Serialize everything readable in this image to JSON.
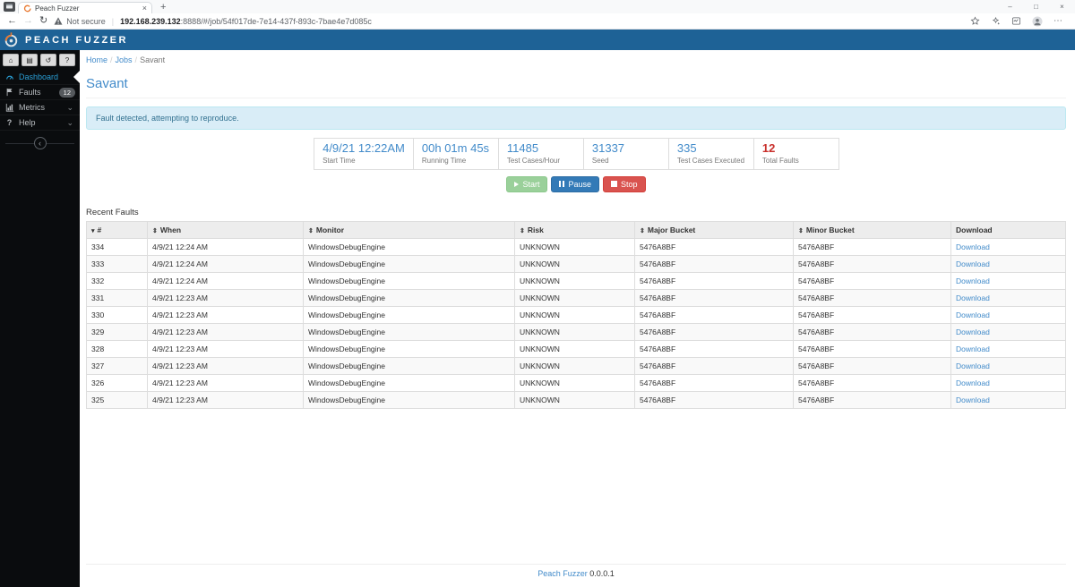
{
  "browser": {
    "tab_title": "Peach Fuzzer",
    "security_label": "Not secure",
    "url_divider": "|",
    "url_host": "192.168.239.132",
    "url_path": ":8888/#/job/54f017de-7e14-437f-893c-7bae4e7d085c"
  },
  "icons": {
    "back": "←",
    "forward": "→",
    "refresh": "↻",
    "minimize": "–",
    "maximize": "□",
    "close": "×",
    "new_tab": "+",
    "tab_close": "×",
    "menu_ellipsis": "⋯",
    "home": "⌂",
    "book": "▤",
    "history": "↺",
    "help": "?",
    "chevron_down": "⌄",
    "collapse": "‹",
    "sort_desc": "▾",
    "sort_both": "⇕"
  },
  "header": {
    "brand": "PEACH FUZZER"
  },
  "sidebar": {
    "items": [
      {
        "label": "Dashboard"
      },
      {
        "label": "Faults",
        "badge": "12"
      },
      {
        "label": "Metrics"
      },
      {
        "label": "Help"
      }
    ]
  },
  "breadcrumb": {
    "items": [
      "Home",
      "Jobs",
      "Savant"
    ],
    "separator": "/"
  },
  "page": {
    "title": "Savant",
    "alert": "Fault detected, attempting to reproduce."
  },
  "stats": [
    {
      "value": "4/9/21 12:22AM",
      "label": "Start Time"
    },
    {
      "value": "00h 01m 45s",
      "label": "Running Time"
    },
    {
      "value": "11485",
      "label": "Test Cases/Hour"
    },
    {
      "value": "31337",
      "label": "Seed"
    },
    {
      "value": "335",
      "label": "Test Cases Executed"
    },
    {
      "value": "12",
      "label": "Total Faults"
    }
  ],
  "controls": {
    "start": "Start",
    "pause": "Pause",
    "stop": "Stop"
  },
  "recent_faults": {
    "heading": "Recent Faults",
    "columns": [
      "#",
      "When",
      "Monitor",
      "Risk",
      "Major Bucket",
      "Minor Bucket",
      "Download"
    ],
    "rows": [
      {
        "num": "334",
        "when": "4/9/21 12:24 AM",
        "monitor": "WindowsDebugEngine",
        "risk": "UNKNOWN",
        "major": "5476A8BF",
        "minor": "5476A8BF",
        "download": "Download"
      },
      {
        "num": "333",
        "when": "4/9/21 12:24 AM",
        "monitor": "WindowsDebugEngine",
        "risk": "UNKNOWN",
        "major": "5476A8BF",
        "minor": "5476A8BF",
        "download": "Download"
      },
      {
        "num": "332",
        "when": "4/9/21 12:24 AM",
        "monitor": "WindowsDebugEngine",
        "risk": "UNKNOWN",
        "major": "5476A8BF",
        "minor": "5476A8BF",
        "download": "Download"
      },
      {
        "num": "331",
        "when": "4/9/21 12:23 AM",
        "monitor": "WindowsDebugEngine",
        "risk": "UNKNOWN",
        "major": "5476A8BF",
        "minor": "5476A8BF",
        "download": "Download"
      },
      {
        "num": "330",
        "when": "4/9/21 12:23 AM",
        "monitor": "WindowsDebugEngine",
        "risk": "UNKNOWN",
        "major": "5476A8BF",
        "minor": "5476A8BF",
        "download": "Download"
      },
      {
        "num": "329",
        "when": "4/9/21 12:23 AM",
        "monitor": "WindowsDebugEngine",
        "risk": "UNKNOWN",
        "major": "5476A8BF",
        "minor": "5476A8BF",
        "download": "Download"
      },
      {
        "num": "328",
        "when": "4/9/21 12:23 AM",
        "monitor": "WindowsDebugEngine",
        "risk": "UNKNOWN",
        "major": "5476A8BF",
        "minor": "5476A8BF",
        "download": "Download"
      },
      {
        "num": "327",
        "when": "4/9/21 12:23 AM",
        "monitor": "WindowsDebugEngine",
        "risk": "UNKNOWN",
        "major": "5476A8BF",
        "minor": "5476A8BF",
        "download": "Download"
      },
      {
        "num": "326",
        "when": "4/9/21 12:23 AM",
        "monitor": "WindowsDebugEngine",
        "risk": "UNKNOWN",
        "major": "5476A8BF",
        "minor": "5476A8BF",
        "download": "Download"
      },
      {
        "num": "325",
        "when": "4/9/21 12:23 AM",
        "monitor": "WindowsDebugEngine",
        "risk": "UNKNOWN",
        "major": "5476A8BF",
        "minor": "5476A8BF",
        "download": "Download"
      }
    ]
  },
  "footer": {
    "link": "Peach Fuzzer",
    "version": "0.0.0.1"
  }
}
